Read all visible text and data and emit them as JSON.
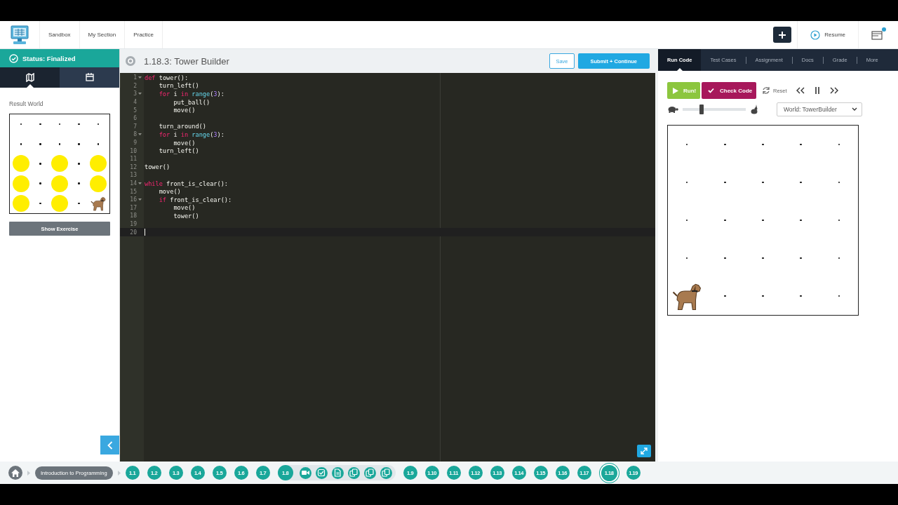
{
  "header": {
    "nav": [
      {
        "label": "Sandbox"
      },
      {
        "label": "My Section"
      },
      {
        "label": "Practice"
      }
    ],
    "resume": {
      "label": "Resume"
    },
    "notification": true
  },
  "status": {
    "label": "Status: Finalized"
  },
  "left_tabs": [
    {
      "kind": "map",
      "selected": true
    },
    {
      "kind": "calendar",
      "selected": false
    }
  ],
  "result_world": {
    "title": "Result World",
    "rows": [
      {
        "cells": [
          {
            "kind": "dot"
          },
          {
            "kind": "dot"
          },
          {
            "kind": "dot"
          },
          {
            "kind": "dot"
          },
          {
            "kind": "dot"
          }
        ]
      },
      {
        "cells": [
          {
            "kind": "dot"
          },
          {
            "kind": "dot"
          },
          {
            "kind": "dot"
          },
          {
            "kind": "dot"
          },
          {
            "kind": "dot"
          }
        ]
      },
      {
        "cells": [
          {
            "kind": "ball"
          },
          {
            "kind": "dot"
          },
          {
            "kind": "ball"
          },
          {
            "kind": "dot"
          },
          {
            "kind": "ball"
          }
        ]
      },
      {
        "cells": [
          {
            "kind": "ball"
          },
          {
            "kind": "dot"
          },
          {
            "kind": "ball"
          },
          {
            "kind": "dot"
          },
          {
            "kind": "ball"
          }
        ]
      },
      {
        "cells": [
          {
            "kind": "ball"
          },
          {
            "kind": "dot"
          },
          {
            "kind": "ball"
          },
          {
            "kind": "dot"
          },
          {
            "kind": "dog"
          }
        ]
      }
    ]
  },
  "show_exercise": {
    "label": "Show Exercise"
  },
  "editor": {
    "title": "1.18.3: Tower Builder",
    "save": "Save",
    "submit": "Submit + Continue",
    "lines": [
      {
        "number": "1",
        "fold": true,
        "active": false,
        "tokens": [
          {
            "kind": "keyword",
            "text": "def"
          },
          {
            "kind": "plain",
            "text": " tower():"
          }
        ]
      },
      {
        "number": "2",
        "fold": false,
        "active": false,
        "tokens": [
          {
            "kind": "plain",
            "text": "    turn_left()"
          }
        ]
      },
      {
        "number": "3",
        "fold": true,
        "active": false,
        "tokens": [
          {
            "kind": "keyword",
            "text": "    for"
          },
          {
            "kind": "plain",
            "text": " i "
          },
          {
            "kind": "keyword",
            "text": "in"
          },
          {
            "kind": "builtin",
            "text": " range"
          },
          {
            "kind": "plain",
            "text": "("
          },
          {
            "kind": "number",
            "text": "3"
          },
          {
            "kind": "plain",
            "text": "):"
          }
        ]
      },
      {
        "number": "4",
        "fold": false,
        "active": false,
        "tokens": [
          {
            "kind": "plain",
            "text": "        put_ball()"
          }
        ]
      },
      {
        "number": "5",
        "fold": false,
        "active": false,
        "tokens": [
          {
            "kind": "plain",
            "text": "        move()"
          }
        ]
      },
      {
        "number": "6",
        "fold": false,
        "active": false
      },
      {
        "number": "7",
        "fold": false,
        "active": false,
        "tokens": [
          {
            "kind": "plain",
            "text": "    turn_around()"
          }
        ]
      },
      {
        "number": "8",
        "fold": true,
        "active": false,
        "tokens": [
          {
            "kind": "keyword",
            "text": "    for"
          },
          {
            "kind": "plain",
            "text": " i "
          },
          {
            "kind": "keyword",
            "text": "in"
          },
          {
            "kind": "builtin",
            "text": " range"
          },
          {
            "kind": "plain",
            "text": "("
          },
          {
            "kind": "number",
            "text": "3"
          },
          {
            "kind": "plain",
            "text": "):"
          }
        ]
      },
      {
        "number": "9",
        "fold": false,
        "active": false,
        "tokens": [
          {
            "kind": "plain",
            "text": "        move()"
          }
        ]
      },
      {
        "number": "10",
        "fold": false,
        "active": false,
        "tokens": [
          {
            "kind": "plain",
            "text": "    turn_left()"
          }
        ]
      },
      {
        "number": "11",
        "fold": false,
        "active": false
      },
      {
        "number": "12",
        "fold": false,
        "active": false,
        "tokens": [
          {
            "kind": "plain",
            "text": "tower()"
          }
        ]
      },
      {
        "number": "13",
        "fold": false,
        "active": false
      },
      {
        "number": "14",
        "fold": true,
        "active": false,
        "tokens": [
          {
            "kind": "keyword",
            "text": "while"
          },
          {
            "kind": "plain",
            "text": " front_is_clear():"
          }
        ]
      },
      {
        "number": "15",
        "fold": false,
        "active": false,
        "tokens": [
          {
            "kind": "plain",
            "text": "    move()"
          }
        ]
      },
      {
        "number": "16",
        "fold": true,
        "active": false,
        "tokens": [
          {
            "kind": "keyword",
            "text": "    if"
          },
          {
            "kind": "plain",
            "text": " front_is_clear():"
          }
        ]
      },
      {
        "number": "17",
        "fold": false,
        "active": false,
        "tokens": [
          {
            "kind": "plain",
            "text": "        move()"
          }
        ]
      },
      {
        "number": "18",
        "fold": false,
        "active": false,
        "tokens": [
          {
            "kind": "plain",
            "text": "        tower()"
          }
        ]
      },
      {
        "number": "19",
        "fold": false,
        "active": false
      },
      {
        "number": "20",
        "fold": false,
        "active": true
      }
    ]
  },
  "right_tabs": [
    {
      "label": "Run Code",
      "selected": true
    },
    {
      "label": "Test Cases",
      "selected": false
    },
    {
      "label": "Assignment",
      "selected": false
    },
    {
      "label": "Docs",
      "selected": false
    },
    {
      "label": "Grade",
      "selected": false
    },
    {
      "label": "More",
      "selected": false
    }
  ],
  "controls": {
    "run": "Run!",
    "check": "Check Code",
    "reset": "Reset",
    "speed": {
      "level": 0.28
    },
    "world_select": "World: TowerBuilder"
  },
  "world": {
    "rows": [
      {
        "cells": [
          {
            "kind": "dot"
          },
          {
            "kind": "dot"
          },
          {
            "kind": "dot"
          },
          {
            "kind": "dot"
          },
          {
            "kind": "dot"
          }
        ]
      },
      {
        "cells": [
          {
            "kind": "dot"
          },
          {
            "kind": "dot"
          },
          {
            "kind": "dot"
          },
          {
            "kind": "dot"
          },
          {
            "kind": "dot"
          }
        ]
      },
      {
        "cells": [
          {
            "kind": "dot"
          },
          {
            "kind": "dot"
          },
          {
            "kind": "dot"
          },
          {
            "kind": "dot"
          },
          {
            "kind": "dot"
          }
        ]
      },
      {
        "cells": [
          {
            "kind": "dot"
          },
          {
            "kind": "dot"
          },
          {
            "kind": "dot"
          },
          {
            "kind": "dot"
          },
          {
            "kind": "dot"
          }
        ]
      },
      {
        "cells": [
          {
            "kind": "dog"
          },
          {
            "kind": "dot"
          },
          {
            "kind": "dot"
          },
          {
            "kind": "dot"
          },
          {
            "kind": "dot"
          }
        ]
      }
    ]
  },
  "course": {
    "label": "Introduction to Programming"
  },
  "lessons": [
    {
      "label": "1.1",
      "selected": false
    },
    {
      "label": "1.2",
      "selected": false
    },
    {
      "label": "1.3",
      "selected": false
    },
    {
      "label": "1.4",
      "selected": false
    },
    {
      "label": "1.5",
      "selected": false
    },
    {
      "label": "1.6",
      "selected": false
    },
    {
      "label": "1.7",
      "selected": false
    },
    {
      "label": "1.8",
      "selected": false,
      "activities": [
        {
          "kind": "video"
        },
        {
          "kind": "quiz"
        },
        {
          "kind": "doc"
        },
        {
          "kind": "exercise"
        },
        {
          "kind": "exercise"
        },
        {
          "kind": "exercise"
        }
      ]
    },
    {
      "label": "1.9",
      "selected": false
    },
    {
      "label": "1.10",
      "selected": false
    },
    {
      "label": "1.11",
      "selected": false
    },
    {
      "label": "1.12",
      "selected": false
    },
    {
      "label": "1.13",
      "selected": false
    },
    {
      "label": "1.14",
      "selected": false
    },
    {
      "label": "1.15",
      "selected": false
    },
    {
      "label": "1.16",
      "selected": false
    },
    {
      "label": "1.17",
      "selected": false
    },
    {
      "label": "1.18",
      "selected": true
    },
    {
      "label": "1.19",
      "selected": false
    }
  ]
}
